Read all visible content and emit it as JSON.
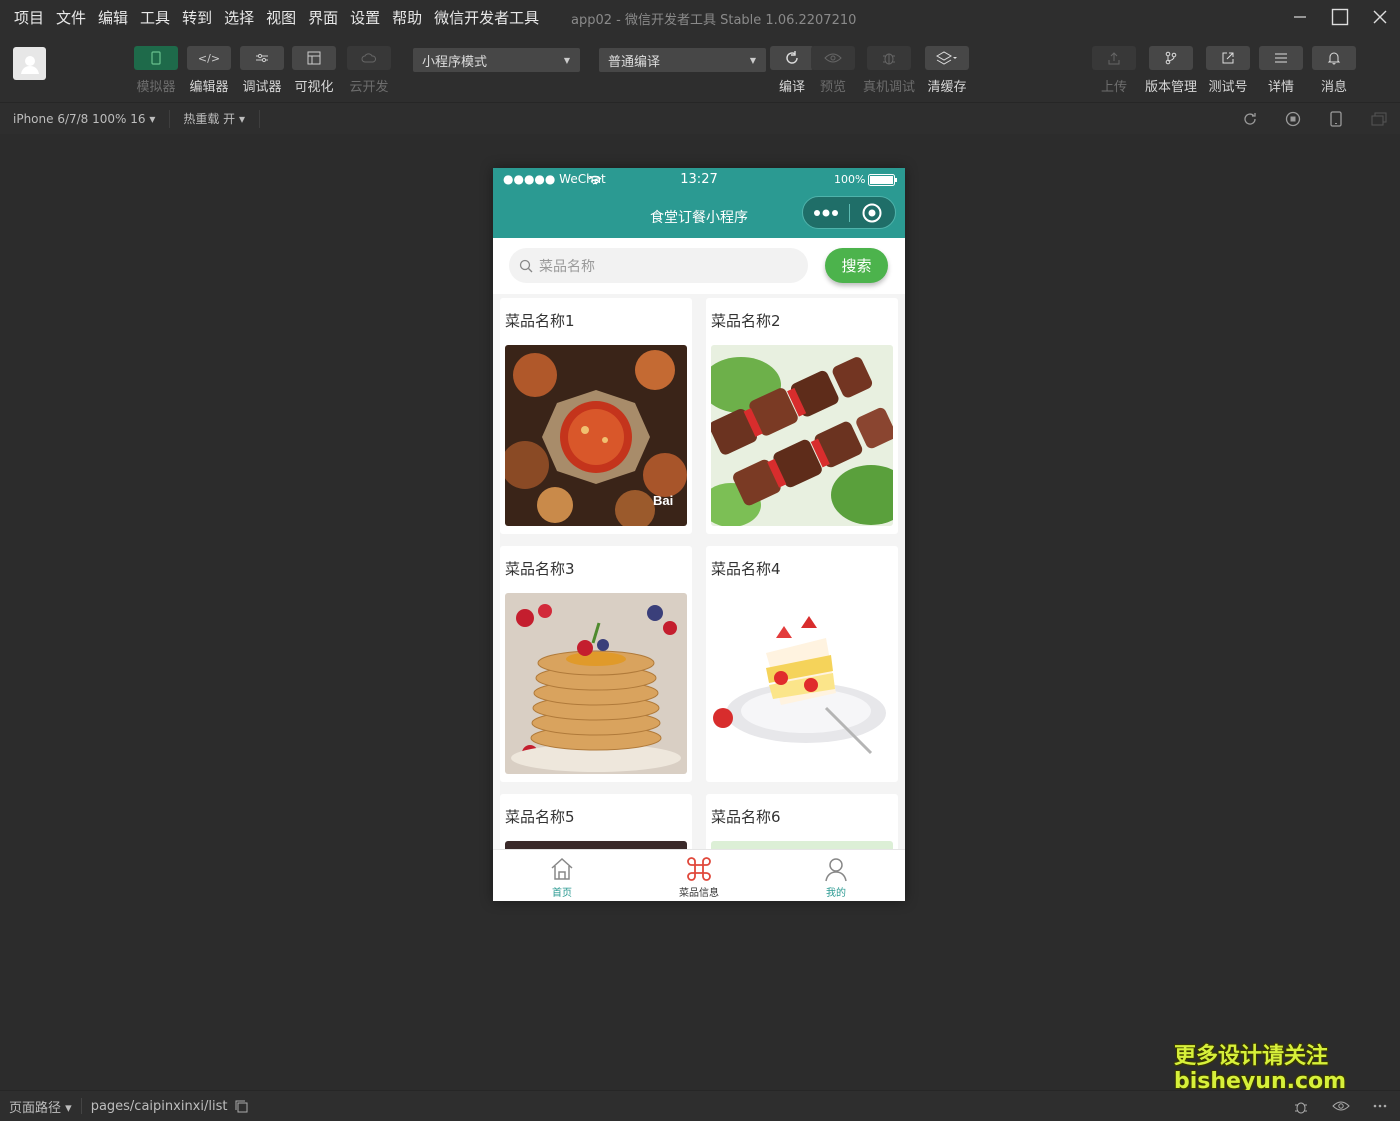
{
  "menubar": {
    "items": [
      "项目",
      "文件",
      "编辑",
      "工具",
      "转到",
      "选择",
      "视图",
      "界面",
      "设置",
      "帮助",
      "微信开发者工具"
    ],
    "window_title": "app02 - 微信开发者工具 Stable 1.06.2207210"
  },
  "toolbar": {
    "left_buttons": [
      {
        "label": "模拟器",
        "icon": "phone-icon"
      },
      {
        "label": "编辑器",
        "icon": "code-icon"
      },
      {
        "label": "调试器",
        "icon": "sliders-icon"
      },
      {
        "label": "可视化",
        "icon": "layout-icon"
      },
      {
        "label": "云开发",
        "icon": "cloud-icon"
      }
    ],
    "mode_select": "小程序模式",
    "compile_select": "普通编译",
    "mid_buttons": [
      {
        "label": "编译",
        "icon": "refresh-icon"
      },
      {
        "label": "预览",
        "icon": "eye-icon"
      },
      {
        "label": "真机调试",
        "icon": "bug-icon"
      },
      {
        "label": "清缓存",
        "icon": "layers-icon"
      }
    ],
    "right_buttons": [
      {
        "label": "上传",
        "icon": "upload-icon"
      },
      {
        "label": "版本管理",
        "icon": "branch-icon"
      },
      {
        "label": "测试号",
        "icon": "external-icon"
      },
      {
        "label": "详情",
        "icon": "menu-icon"
      },
      {
        "label": "消息",
        "icon": "bell-icon"
      }
    ]
  },
  "subbar": {
    "device": "iPhone 6/7/8 100% 16",
    "hot_reload": "热重载 开"
  },
  "phone": {
    "status": {
      "carrier": "●●●●● WeChat",
      "time": "13:27",
      "battery": "100%"
    },
    "nav_title": "食堂订餐小程序",
    "search_placeholder": "菜品名称",
    "search_button": "搜索",
    "cards": [
      {
        "title": "菜品名称1",
        "image": "hotpot-photo"
      },
      {
        "title": "菜品名称2",
        "image": "meat-skewers-photo"
      },
      {
        "title": "菜品名称3",
        "image": "pancakes-photo"
      },
      {
        "title": "菜品名称4",
        "image": "strawberry-cake-photo"
      },
      {
        "title": "菜品名称5",
        "image": "dark-food-photo"
      },
      {
        "title": "菜品名称6",
        "image": "green-food-photo"
      }
    ],
    "tabs": [
      {
        "label": "首页",
        "icon": "home-icon",
        "color": "#2b9a92"
      },
      {
        "label": "菜品信息",
        "icon": "command-icon",
        "color": "#333333"
      },
      {
        "label": "我的",
        "icon": "user-icon",
        "color": "#2b9a92"
      }
    ]
  },
  "bottombar": {
    "path_label": "页面路径",
    "path": "pages/caipinxinxi/list"
  },
  "watermark": {
    "line1": "更多设计请关注",
    "line2": "bisheyun.com"
  },
  "colors": {
    "accent": "#2b9a92",
    "search_button": "#4cb34c",
    "active_tab_icon": "#e0483b"
  }
}
